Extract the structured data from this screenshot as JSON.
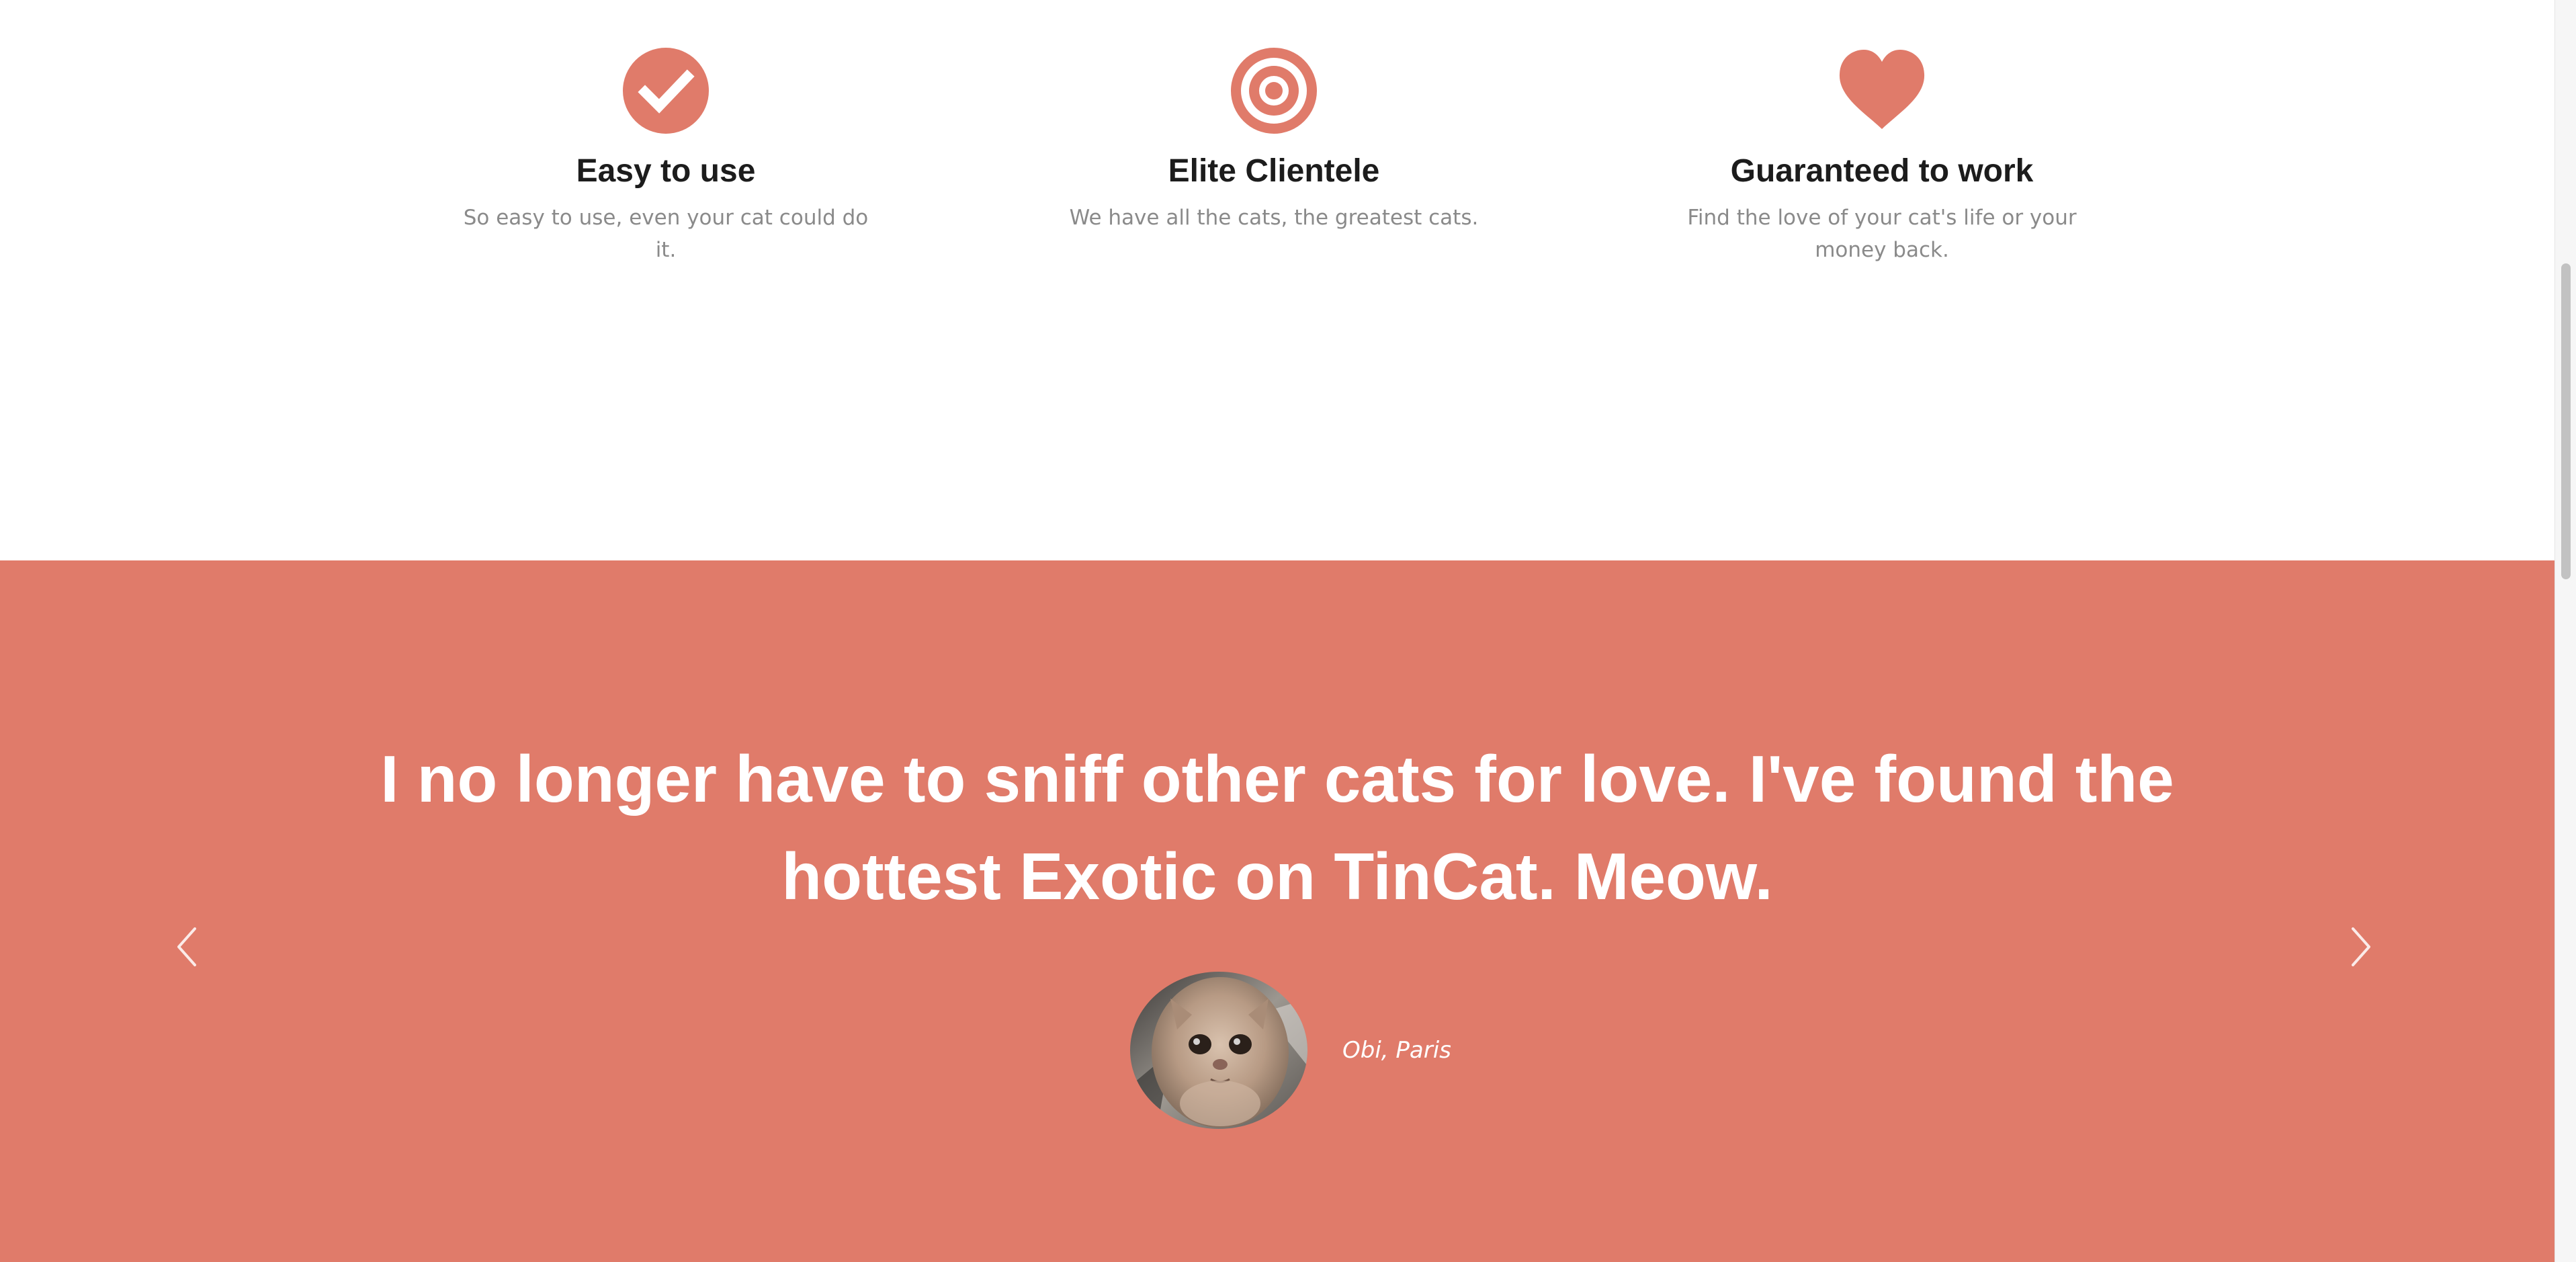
{
  "features": [
    {
      "icon": "check-circle-icon",
      "title": "Easy to use",
      "text": "So easy to use, even your cat could do it."
    },
    {
      "icon": "target-icon",
      "title": "Elite Clientele",
      "text": "We have all the cats, the greatest cats."
    },
    {
      "icon": "heart-icon",
      "title": "Guaranteed to work",
      "text": "Find the love of your cat's life or your money back."
    }
  ],
  "testimonial": {
    "quote": "I no longer have to sniff other cats for love. I've found the hottest Exotic on TinCat. Meow.",
    "author": "Obi, Paris",
    "avatar": "cat-avatar-photo"
  },
  "carousel": {
    "prev_icon": "chevron-left-icon",
    "next_icon": "chevron-right-icon"
  },
  "colors": {
    "accent": "#e07b6a",
    "heading": "#1c1c1c",
    "body_text": "#8a8a8a",
    "quote_text": "#ffffff"
  }
}
